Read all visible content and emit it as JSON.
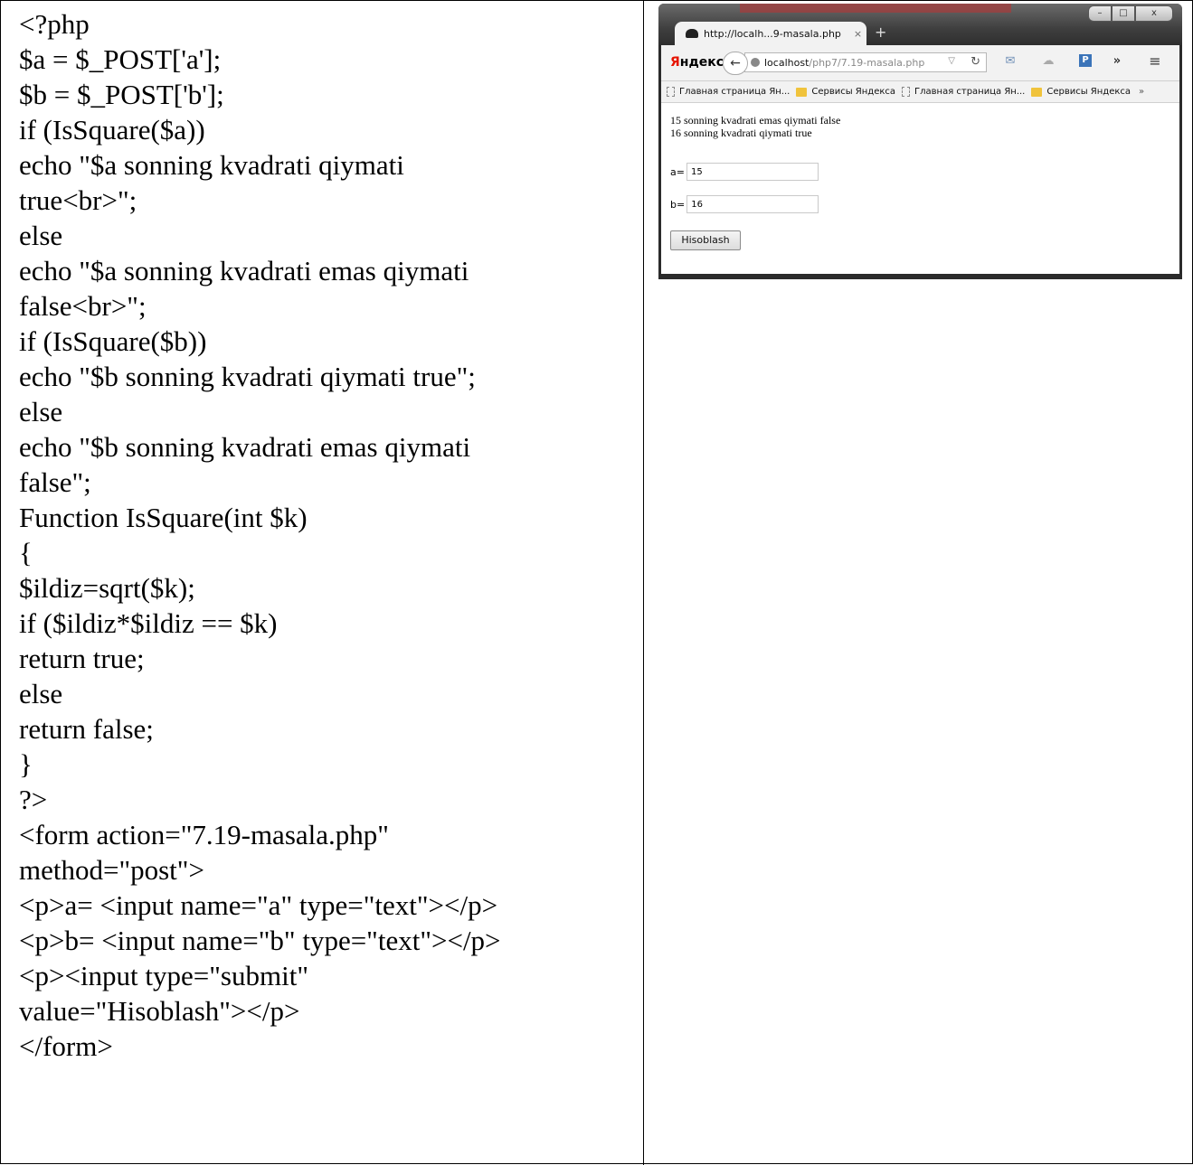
{
  "code_lines": [
    "<?php",
    "$a = $_POST['a'];",
    "$b = $_POST['b'];",
    "if (IsSquare($a))",
    "echo \"$a sonning kvadrati qiymati",
    "true<br>\";",
    "else",
    "echo \"$a sonning kvadrati emas qiymati",
    "false<br>\";",
    "if (IsSquare($b))",
    "echo \"$b sonning kvadrati qiymati true\";",
    "else",
    "echo \"$b sonning kvadrati emas qiymati",
    "false\";",
    "Function IsSquare(int $k)",
    "{",
    "$ildiz=sqrt($k);",
    "if ($ildiz*$ildiz == $k)",
    "return true;",
    "else",
    "return false;",
    "}",
    "?>",
    "<form action=\"7.19-masala.php\"",
    "method=\"post\">",
    "<p>a= <input name=\"a\" type=\"text\"></p>",
    "<p>b= <input name=\"b\" type=\"text\"></p>",
    "<p><input type=\"submit\"",
    "value=\"Hisoblash\"></p>",
    "</form>"
  ],
  "browser": {
    "tab_title": "http://localh...9-masala.php",
    "tab_close": "×",
    "new_tab": "+",
    "brand_first": "Я",
    "brand_rest": "ндекс",
    "url_host": "localhost",
    "url_path": "/php7/7.19-masala.php",
    "bookmarks": [
      {
        "label": "Главная страница Ян...",
        "icon": "page-icon"
      },
      {
        "label": "Сервисы Яндекса",
        "icon": "folder-icon"
      },
      {
        "label": "Главная страница Ян...",
        "icon": "page-icon"
      },
      {
        "label": "Сервисы Яндекса",
        "icon": "folder-icon"
      }
    ],
    "bookmarks_more": "»",
    "results": [
      "15 sonning kvadrati emas qiymati false",
      "16 sonning kvadrati qiymati true"
    ],
    "label_a": "a=",
    "value_a": "15",
    "label_b": "b=",
    "value_b": "16",
    "submit_label": "Hisoblash"
  }
}
